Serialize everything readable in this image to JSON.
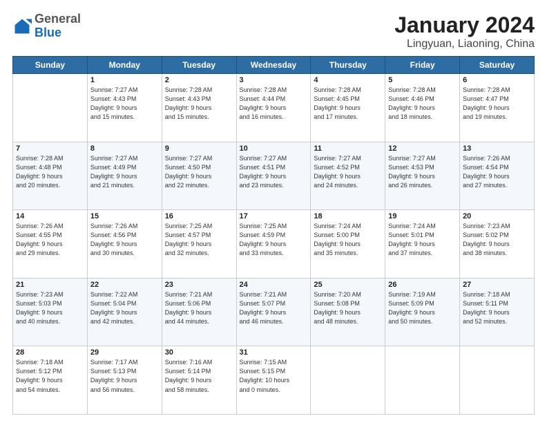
{
  "header": {
    "logo_general": "General",
    "logo_blue": "Blue",
    "title": "January 2024",
    "subtitle": "Lingyuan, Liaoning, China"
  },
  "columns": [
    "Sunday",
    "Monday",
    "Tuesday",
    "Wednesday",
    "Thursday",
    "Friday",
    "Saturday"
  ],
  "weeks": [
    [
      {
        "day": "",
        "info": ""
      },
      {
        "day": "1",
        "info": "Sunrise: 7:27 AM\nSunset: 4:43 PM\nDaylight: 9 hours\nand 15 minutes."
      },
      {
        "day": "2",
        "info": "Sunrise: 7:28 AM\nSunset: 4:43 PM\nDaylight: 9 hours\nand 15 minutes."
      },
      {
        "day": "3",
        "info": "Sunrise: 7:28 AM\nSunset: 4:44 PM\nDaylight: 9 hours\nand 16 minutes."
      },
      {
        "day": "4",
        "info": "Sunrise: 7:28 AM\nSunset: 4:45 PM\nDaylight: 9 hours\nand 17 minutes."
      },
      {
        "day": "5",
        "info": "Sunrise: 7:28 AM\nSunset: 4:46 PM\nDaylight: 9 hours\nand 18 minutes."
      },
      {
        "day": "6",
        "info": "Sunrise: 7:28 AM\nSunset: 4:47 PM\nDaylight: 9 hours\nand 19 minutes."
      }
    ],
    [
      {
        "day": "7",
        "info": "Sunrise: 7:28 AM\nSunset: 4:48 PM\nDaylight: 9 hours\nand 20 minutes."
      },
      {
        "day": "8",
        "info": "Sunrise: 7:27 AM\nSunset: 4:49 PM\nDaylight: 9 hours\nand 21 minutes."
      },
      {
        "day": "9",
        "info": "Sunrise: 7:27 AM\nSunset: 4:50 PM\nDaylight: 9 hours\nand 22 minutes."
      },
      {
        "day": "10",
        "info": "Sunrise: 7:27 AM\nSunset: 4:51 PM\nDaylight: 9 hours\nand 23 minutes."
      },
      {
        "day": "11",
        "info": "Sunrise: 7:27 AM\nSunset: 4:52 PM\nDaylight: 9 hours\nand 24 minutes."
      },
      {
        "day": "12",
        "info": "Sunrise: 7:27 AM\nSunset: 4:53 PM\nDaylight: 9 hours\nand 26 minutes."
      },
      {
        "day": "13",
        "info": "Sunrise: 7:26 AM\nSunset: 4:54 PM\nDaylight: 9 hours\nand 27 minutes."
      }
    ],
    [
      {
        "day": "14",
        "info": "Sunrise: 7:26 AM\nSunset: 4:55 PM\nDaylight: 9 hours\nand 29 minutes."
      },
      {
        "day": "15",
        "info": "Sunrise: 7:26 AM\nSunset: 4:56 PM\nDaylight: 9 hours\nand 30 minutes."
      },
      {
        "day": "16",
        "info": "Sunrise: 7:25 AM\nSunset: 4:57 PM\nDaylight: 9 hours\nand 32 minutes."
      },
      {
        "day": "17",
        "info": "Sunrise: 7:25 AM\nSunset: 4:59 PM\nDaylight: 9 hours\nand 33 minutes."
      },
      {
        "day": "18",
        "info": "Sunrise: 7:24 AM\nSunset: 5:00 PM\nDaylight: 9 hours\nand 35 minutes."
      },
      {
        "day": "19",
        "info": "Sunrise: 7:24 AM\nSunset: 5:01 PM\nDaylight: 9 hours\nand 37 minutes."
      },
      {
        "day": "20",
        "info": "Sunrise: 7:23 AM\nSunset: 5:02 PM\nDaylight: 9 hours\nand 38 minutes."
      }
    ],
    [
      {
        "day": "21",
        "info": "Sunrise: 7:23 AM\nSunset: 5:03 PM\nDaylight: 9 hours\nand 40 minutes."
      },
      {
        "day": "22",
        "info": "Sunrise: 7:22 AM\nSunset: 5:04 PM\nDaylight: 9 hours\nand 42 minutes."
      },
      {
        "day": "23",
        "info": "Sunrise: 7:21 AM\nSunset: 5:06 PM\nDaylight: 9 hours\nand 44 minutes."
      },
      {
        "day": "24",
        "info": "Sunrise: 7:21 AM\nSunset: 5:07 PM\nDaylight: 9 hours\nand 46 minutes."
      },
      {
        "day": "25",
        "info": "Sunrise: 7:20 AM\nSunset: 5:08 PM\nDaylight: 9 hours\nand 48 minutes."
      },
      {
        "day": "26",
        "info": "Sunrise: 7:19 AM\nSunset: 5:09 PM\nDaylight: 9 hours\nand 50 minutes."
      },
      {
        "day": "27",
        "info": "Sunrise: 7:18 AM\nSunset: 5:11 PM\nDaylight: 9 hours\nand 52 minutes."
      }
    ],
    [
      {
        "day": "28",
        "info": "Sunrise: 7:18 AM\nSunset: 5:12 PM\nDaylight: 9 hours\nand 54 minutes."
      },
      {
        "day": "29",
        "info": "Sunrise: 7:17 AM\nSunset: 5:13 PM\nDaylight: 9 hours\nand 56 minutes."
      },
      {
        "day": "30",
        "info": "Sunrise: 7:16 AM\nSunset: 5:14 PM\nDaylight: 9 hours\nand 58 minutes."
      },
      {
        "day": "31",
        "info": "Sunrise: 7:15 AM\nSunset: 5:15 PM\nDaylight: 10 hours\nand 0 minutes."
      },
      {
        "day": "",
        "info": ""
      },
      {
        "day": "",
        "info": ""
      },
      {
        "day": "",
        "info": ""
      }
    ]
  ]
}
